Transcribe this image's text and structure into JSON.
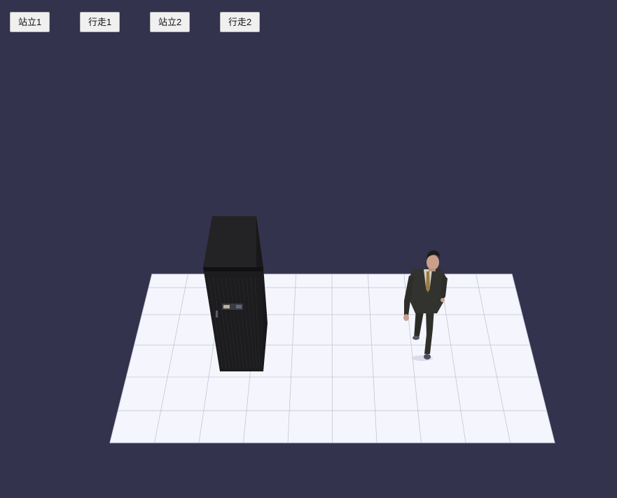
{
  "toolbar": {
    "buttons": [
      "站立1",
      "行走1",
      "站立2",
      "行走2"
    ]
  },
  "colors": {
    "background": "#33334d",
    "floor": "#f5f6fd",
    "grid_line": "#c3c4d8",
    "cabinet": "#1f1f21",
    "suit": "#2e2e2b"
  },
  "scene": {
    "objects": [
      "floor-grid",
      "server-cabinet",
      "walking-man"
    ]
  }
}
